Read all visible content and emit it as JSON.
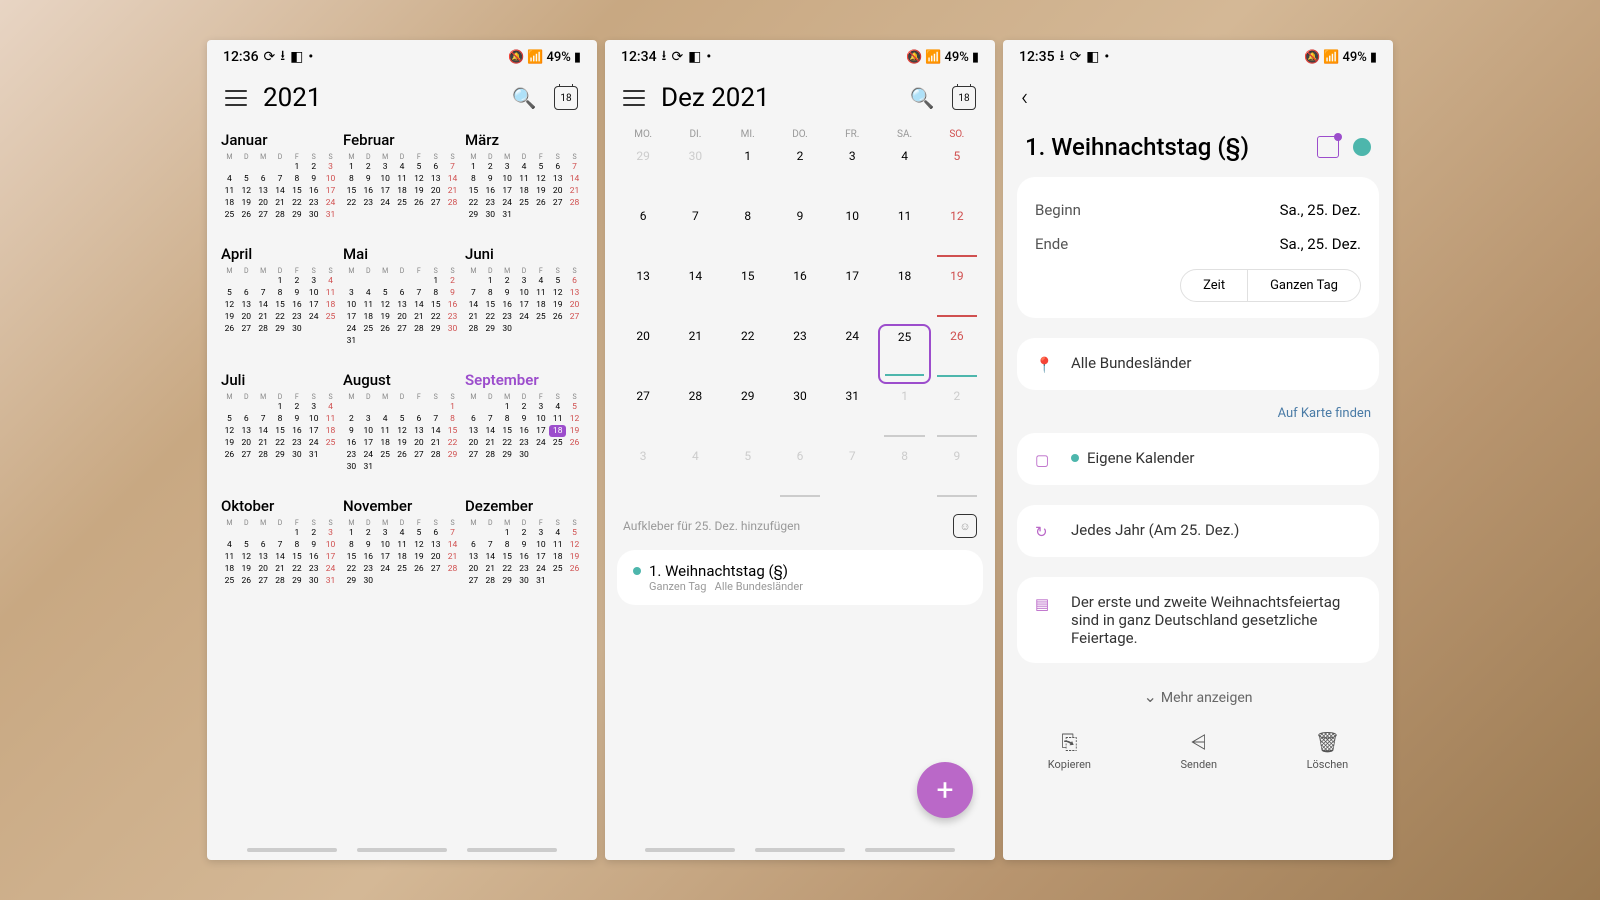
{
  "status": {
    "times": [
      "12:36",
      "12:34",
      "12:35"
    ],
    "battery": "49%",
    "cal_badge": "18"
  },
  "dow_short": [
    "M",
    "D",
    "M",
    "D",
    "F",
    "S",
    "S"
  ],
  "dow_month": [
    "MO.",
    "DI.",
    "MI.",
    "DO.",
    "FR.",
    "SA.",
    "SO."
  ],
  "year": {
    "title": "2021",
    "months": [
      {
        "name": "Januar",
        "lead": 4,
        "days": 31,
        "sun_col": 6,
        "today": 0
      },
      {
        "name": "Februar",
        "lead": 0,
        "days": 28,
        "sun_col": 6,
        "today": 0
      },
      {
        "name": "März",
        "lead": 0,
        "days": 31,
        "sun_col": 6,
        "today": 0
      },
      {
        "name": "April",
        "lead": 3,
        "days": 30,
        "sun_col": 6,
        "today": 0
      },
      {
        "name": "Mai",
        "lead": 5,
        "days": 31,
        "sun_col": 6,
        "today": 0
      },
      {
        "name": "Juni",
        "lead": 1,
        "days": 30,
        "sun_col": 6,
        "today": 0
      },
      {
        "name": "Juli",
        "lead": 3,
        "days": 31,
        "sun_col": 6,
        "today": 0
      },
      {
        "name": "August",
        "lead": 6,
        "days": 31,
        "sun_col": 6,
        "today": 0
      },
      {
        "name": "September",
        "lead": 2,
        "days": 30,
        "sun_col": 6,
        "today": 18,
        "current": true
      },
      {
        "name": "Oktober",
        "lead": 4,
        "days": 31,
        "sun_col": 6,
        "today": 0
      },
      {
        "name": "November",
        "lead": 0,
        "days": 30,
        "sun_col": 6,
        "today": 0
      },
      {
        "name": "Dezember",
        "lead": 2,
        "days": 31,
        "sun_col": 6,
        "today": 0
      }
    ]
  },
  "month": {
    "title": "Dez 2021",
    "lead_prev": [
      29,
      30
    ],
    "days": 31,
    "trail_next": [
      1,
      2,
      3,
      4,
      5,
      6,
      7,
      8,
      9
    ],
    "selected": 25,
    "sun_days": [
      5,
      12,
      19,
      26
    ],
    "marks_teal": [
      25,
      26,
      6,
      1,
      2
    ],
    "marks_red": [
      12,
      19
    ],
    "sticker_prompt": "Aufkleber für 25. Dez. hinzufügen",
    "event": {
      "title": "1. Weihnachtstag (§)",
      "sub1": "Ganzen Tag",
      "sub2": "Alle Bundesländer"
    }
  },
  "detail": {
    "title": "1. Weihnachtstag (§)",
    "begin_label": "Beginn",
    "begin_val": "Sa., 25. Dez.",
    "end_label": "Ende",
    "end_val": "Sa., 25. Dez.",
    "pill_time": "Zeit",
    "pill_allday": "Ganzen Tag",
    "location": "Alle Bundesländer",
    "map_link": "Auf Karte finden",
    "calendar": "Eigene Kalender",
    "repeat": "Jedes Jahr (Am 25. Dez.)",
    "note": "Der erste und zweite Weihnachtsfeiertag sind in ganz Deutschland gesetzliche Feiertage.",
    "show_more": "Mehr anzeigen",
    "actions": {
      "copy": "Kopieren",
      "send": "Senden",
      "delete": "Löschen"
    }
  }
}
